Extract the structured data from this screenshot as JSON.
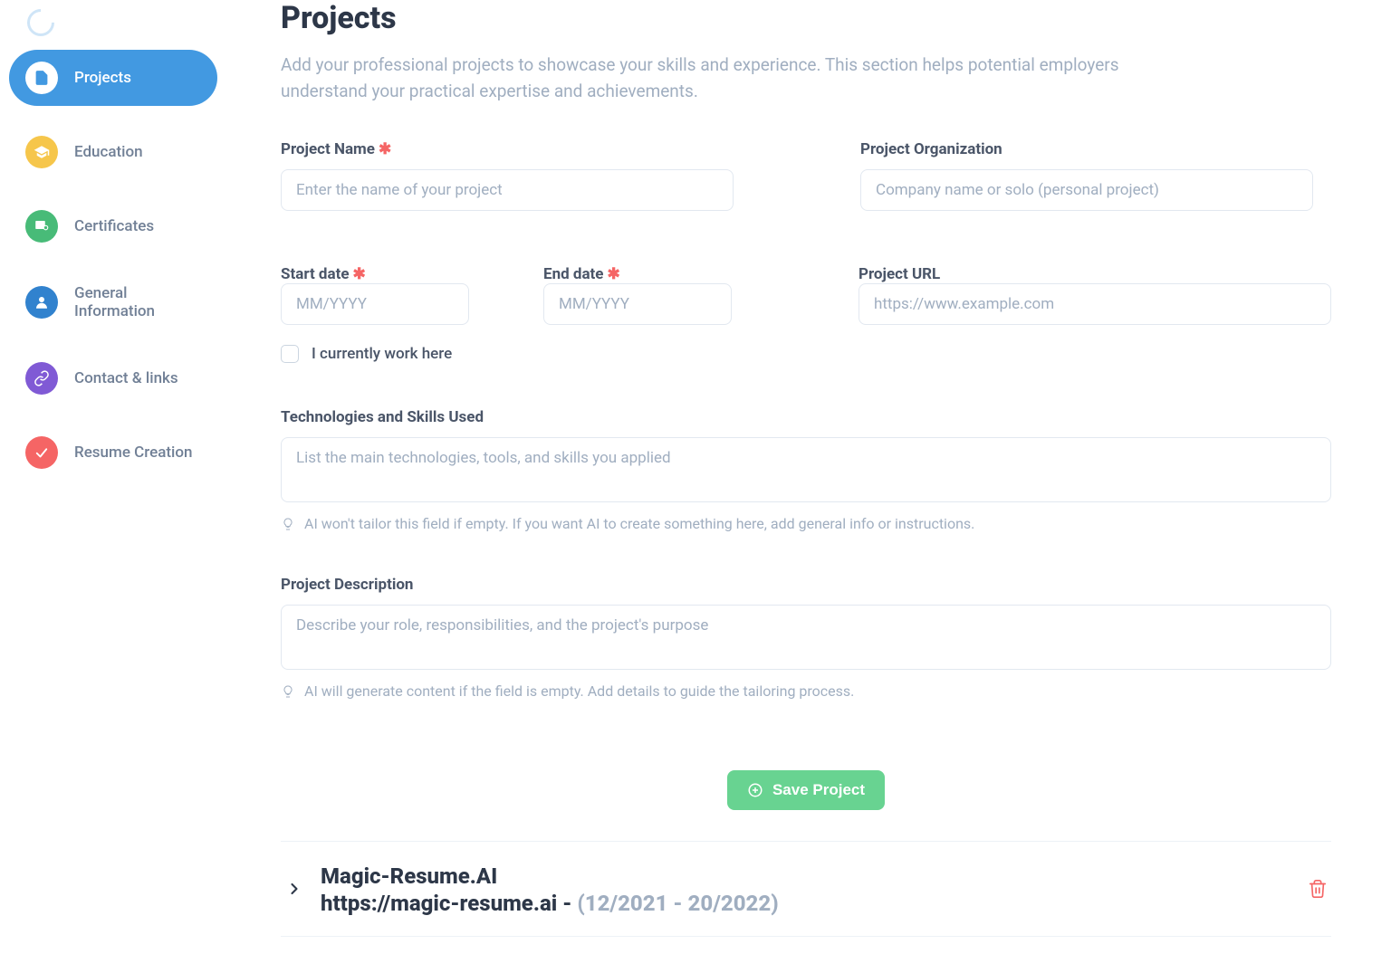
{
  "sidebar": {
    "items": [
      {
        "label": "Projects"
      },
      {
        "label": "Education"
      },
      {
        "label": "Certificates"
      },
      {
        "label": "General Information"
      },
      {
        "label": "Contact & links"
      },
      {
        "label": "Resume Creation"
      }
    ]
  },
  "page": {
    "title": "Projects",
    "subtitle": "Add your professional projects to showcase your skills and experience. This section helps potential employers understand your practical expertise and achievements."
  },
  "form": {
    "project_name": {
      "label": "Project Name",
      "placeholder": "Enter the name of your project"
    },
    "project_org": {
      "label": "Project Organization",
      "placeholder": "Company name or solo (personal project)"
    },
    "start_date": {
      "label": "Start date",
      "placeholder": "MM/YYYY"
    },
    "end_date": {
      "label": "End date",
      "placeholder": "MM/YYYY"
    },
    "project_url": {
      "label": "Project URL",
      "placeholder": "https://www.example.com"
    },
    "currently_work": {
      "label": "I currently work here"
    },
    "technologies": {
      "label": "Technologies and Skills Used",
      "placeholder": "List the main technologies, tools, and skills you applied",
      "hint": "AI won't tailor this field if empty. If you want AI to create something here, add general info or instructions."
    },
    "description": {
      "label": "Project Description",
      "placeholder": "Describe your role, responsibilities, and the project's purpose",
      "hint": "AI will generate content if the field is empty. Add details to guide the tailoring process."
    },
    "save_button": "Save Project"
  },
  "saved": {
    "title": "Magic-Resume.AI",
    "url_line": "https://magic-resume.ai - ",
    "dates": "(12/2021 - 20/2022)"
  }
}
